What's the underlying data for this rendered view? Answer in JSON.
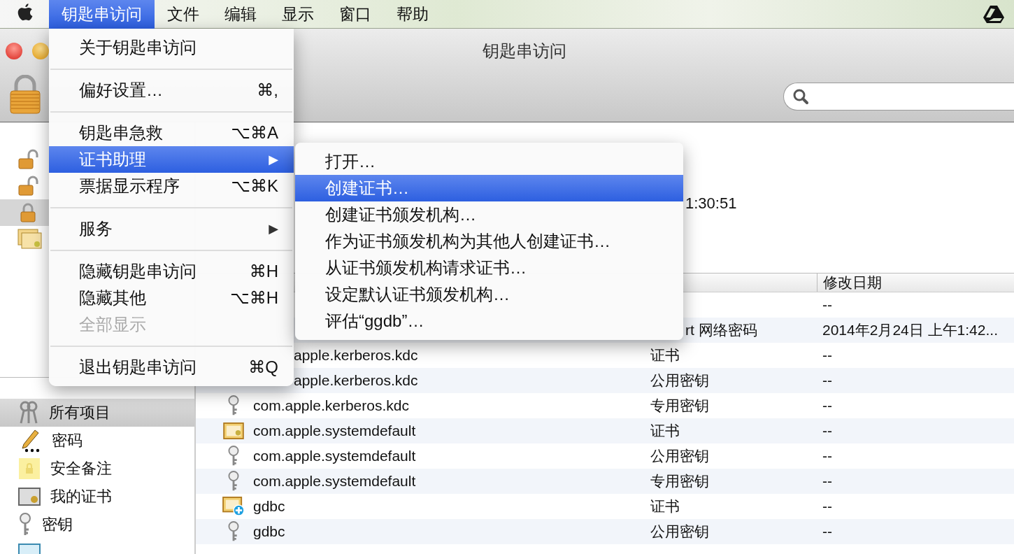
{
  "menubar": {
    "items": [
      {
        "label": "钥匙串访问",
        "selected": true
      },
      {
        "label": "文件",
        "selected": false
      },
      {
        "label": "编辑",
        "selected": false
      },
      {
        "label": "显示",
        "selected": false
      },
      {
        "label": "窗口",
        "selected": false
      },
      {
        "label": "帮助",
        "selected": false
      }
    ]
  },
  "window": {
    "title": "钥匙串访问"
  },
  "sidebar": {
    "keychains": [
      {
        "kind": "unlocked",
        "selected": false
      },
      {
        "kind": "unlocked",
        "selected": false
      },
      {
        "kind": "locked",
        "selected": true
      },
      {
        "kind": "certs",
        "selected": false
      }
    ],
    "categories": [
      {
        "kind": "keys",
        "label": "所有项目",
        "selected": true
      },
      {
        "kind": "pencil",
        "label": "密码",
        "selected": false
      },
      {
        "kind": "note",
        "label": "安全备注",
        "selected": false
      },
      {
        "kind": "my-cert",
        "label": "我的证书",
        "selected": false
      },
      {
        "kind": "key",
        "label": "密钥",
        "selected": false
      },
      {
        "kind": "cert",
        "selected": false
      }
    ]
  },
  "info": {
    "text": "1:30:51"
  },
  "table": {
    "columns": [
      {
        "label": "修改日期"
      }
    ],
    "rows": [
      {
        "date": "--"
      },
      {
        "type": "rt 网络密码",
        "date": "2014年2月24日 上午1:42..."
      },
      {
        "name": "apple.kerberos.kdc",
        "type": "证书",
        "date": "--"
      },
      {
        "name": "apple.kerberos.kdc",
        "type": "公用密钥",
        "date": "--"
      },
      {
        "kind": "key",
        "name": "com.apple.kerberos.kdc",
        "type": "专用密钥",
        "date": "--"
      },
      {
        "kind": "cert",
        "name": "com.apple.systemdefault",
        "type": "证书",
        "date": "--"
      },
      {
        "kind": "key",
        "name": "com.apple.systemdefault",
        "type": "公用密钥",
        "date": "--"
      },
      {
        "kind": "key",
        "name": "com.apple.systemdefault",
        "type": "专用密钥",
        "date": "--"
      },
      {
        "kind": "cert-plus",
        "name": "gdbc",
        "type": "证书",
        "date": "--"
      },
      {
        "kind": "key",
        "name": "gdbc",
        "type": "公用密钥",
        "date": "--"
      }
    ]
  },
  "menu": {
    "items": [
      {
        "kind": "item",
        "label": "关于钥匙串访问",
        "selected": false,
        "disabled": false
      },
      {
        "kind": "separator"
      },
      {
        "kind": "item",
        "label": "偏好设置…",
        "shortcut": "⌘,",
        "selected": false,
        "disabled": false
      },
      {
        "kind": "separator"
      },
      {
        "kind": "item",
        "label": "钥匙串急救",
        "shortcut": "⌥⌘A",
        "selected": false,
        "disabled": false
      },
      {
        "kind": "item",
        "label": "证书助理",
        "arrow": "▶",
        "selected": true,
        "disabled": false
      },
      {
        "kind": "item",
        "label": "票据显示程序",
        "shortcut": "⌥⌘K",
        "selected": false,
        "disabled": false
      },
      {
        "kind": "separator"
      },
      {
        "kind": "item",
        "label": "服务",
        "arrow": "▶",
        "selected": false,
        "disabled": false
      },
      {
        "kind": "separator"
      },
      {
        "kind": "item",
        "label": "隐藏钥匙串访问",
        "shortcut": "⌘H",
        "selected": false,
        "disabled": false
      },
      {
        "kind": "item",
        "label": "隐藏其他",
        "shortcut": "⌥⌘H",
        "selected": false,
        "disabled": false
      },
      {
        "kind": "item",
        "label": "全部显示",
        "selected": false,
        "disabled": true
      },
      {
        "kind": "separator"
      },
      {
        "kind": "item",
        "label": "退出钥匙串访问",
        "shortcut": "⌘Q",
        "selected": false,
        "disabled": false
      }
    ]
  },
  "submenu": {
    "items": [
      {
        "label": "打开…",
        "selected": false
      },
      {
        "label": "创建证书…",
        "selected": true
      },
      {
        "label": "创建证书颁发机构…",
        "selected": false
      },
      {
        "label": "作为证书颁发机构为其他人创建证书…",
        "selected": false
      },
      {
        "label": "从证书颁发机构请求证书…",
        "selected": false
      },
      {
        "label": "设定默认证书颁发机构…",
        "selected": false
      },
      {
        "label": "评估“ggdb”…",
        "selected": false
      }
    ]
  }
}
